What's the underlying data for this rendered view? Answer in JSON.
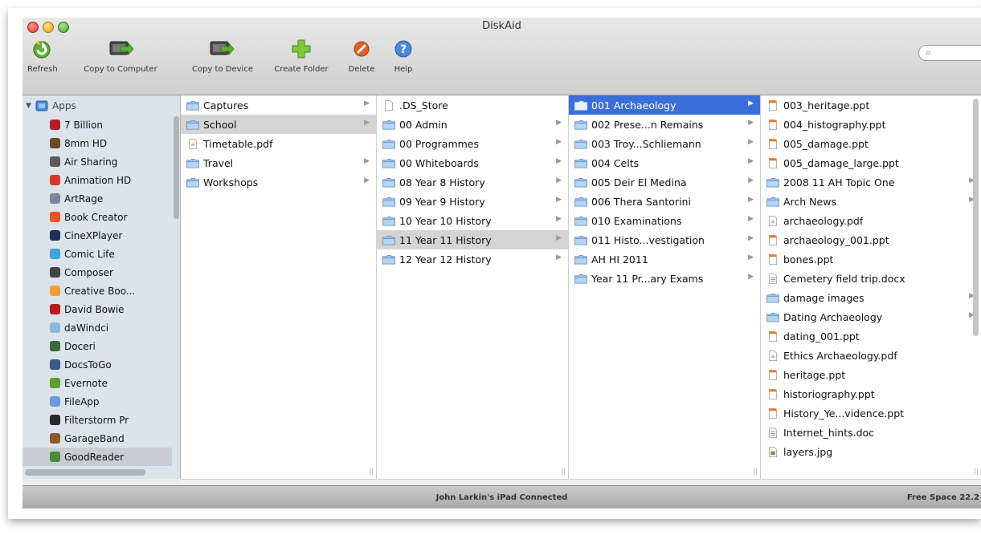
{
  "window": {
    "title": "DiskAid"
  },
  "toolbar": [
    {
      "label": "Refresh",
      "icon": "refresh-icon"
    },
    {
      "label": "Copy to Computer",
      "icon": "copy-to-computer-icon"
    },
    {
      "label": "Copy to Device",
      "icon": "copy-to-device-icon"
    },
    {
      "label": "Create Folder",
      "icon": "create-folder-icon"
    },
    {
      "label": "Delete",
      "icon": "delete-icon"
    },
    {
      "label": "Help",
      "icon": "help-icon"
    }
  ],
  "sidebar": {
    "header": "Apps",
    "items": [
      {
        "label": "7 Billion",
        "color": "#b01f24"
      },
      {
        "label": "8mm HD",
        "color": "#6b4a2a"
      },
      {
        "label": "Air Sharing",
        "color": "#5a5a5a"
      },
      {
        "label": "Animation HD",
        "color": "#d23a2e"
      },
      {
        "label": "ArtRage",
        "color": "#7a86a0"
      },
      {
        "label": "Book Creator",
        "color": "#e8562a"
      },
      {
        "label": "CineXPlayer",
        "color": "#1f2f5a"
      },
      {
        "label": "Comic Life",
        "color": "#3fa4d8"
      },
      {
        "label": "Composer",
        "color": "#444444"
      },
      {
        "label": "Creative Boo...",
        "color": "#f0a030"
      },
      {
        "label": "David Bowie",
        "color": "#b41e1e"
      },
      {
        "label": "daWindci",
        "color": "#8ab8d8"
      },
      {
        "label": "Doceri",
        "color": "#3a6a3a"
      },
      {
        "label": "DocsToGo",
        "color": "#3a5a8a"
      },
      {
        "label": "Evernote",
        "color": "#5aa02c"
      },
      {
        "label": "FileApp",
        "color": "#6a9ad8"
      },
      {
        "label": "Filterstorm Pr",
        "color": "#2a2a2a"
      },
      {
        "label": "GarageBand",
        "color": "#8a5a2a"
      },
      {
        "label": "GoodReader",
        "color": "#4a8a3a",
        "selected": true
      }
    ]
  },
  "columns": [
    {
      "items": [
        {
          "name": "Captures",
          "type": "folder",
          "arrow": true
        },
        {
          "name": "School",
          "type": "folder",
          "arrow": true,
          "selected": "gray"
        },
        {
          "name": "Timetable.pdf",
          "type": "pdf"
        },
        {
          "name": "Travel",
          "type": "folder",
          "arrow": true
        },
        {
          "name": "Workshops",
          "type": "folder",
          "arrow": true
        }
      ]
    },
    {
      "items": [
        {
          "name": ".DS_Store",
          "type": "file"
        },
        {
          "name": "00 Admin",
          "type": "folder",
          "arrow": true
        },
        {
          "name": "00 Programmes",
          "type": "folder",
          "arrow": true
        },
        {
          "name": "00 Whiteboards",
          "type": "folder",
          "arrow": true
        },
        {
          "name": "08 Year 8 History",
          "type": "folder",
          "arrow": true
        },
        {
          "name": "09 Year 9 History",
          "type": "folder",
          "arrow": true
        },
        {
          "name": "10 Year 10 History",
          "type": "folder",
          "arrow": true
        },
        {
          "name": "11 Year 11 History",
          "type": "folder",
          "arrow": true,
          "selected": "gray"
        },
        {
          "name": "12 Year 12 History",
          "type": "folder",
          "arrow": true
        }
      ]
    },
    {
      "items": [
        {
          "name": "001 Archaeology",
          "type": "folder",
          "arrow": true,
          "selected": "blue"
        },
        {
          "name": "002 Prese...n Remains",
          "type": "folder",
          "arrow": true
        },
        {
          "name": "003 Troy...Schliemann",
          "type": "folder",
          "arrow": true
        },
        {
          "name": "004 Celts",
          "type": "folder",
          "arrow": true
        },
        {
          "name": "005 Deir El Medina",
          "type": "folder",
          "arrow": true
        },
        {
          "name": "006 Thera Santorini",
          "type": "folder",
          "arrow": true
        },
        {
          "name": "010 Examinations",
          "type": "folder",
          "arrow": true
        },
        {
          "name": "011 Histo...vestigation",
          "type": "folder",
          "arrow": true
        },
        {
          "name": "AH HI 2011",
          "type": "folder",
          "arrow": true
        },
        {
          "name": "Year 11 Pr...ary Exams",
          "type": "folder",
          "arrow": true
        }
      ]
    },
    {
      "items": [
        {
          "name": "003_heritage.ppt",
          "type": "ppt"
        },
        {
          "name": "004_histography.ppt",
          "type": "ppt"
        },
        {
          "name": "005_damage.ppt",
          "type": "ppt"
        },
        {
          "name": "005_damage_large.ppt",
          "type": "ppt"
        },
        {
          "name": "2008 11 AH Topic One",
          "type": "folder",
          "arrow": true
        },
        {
          "name": "Arch News",
          "type": "folder",
          "arrow": true
        },
        {
          "name": "archaeology.pdf",
          "type": "pdf"
        },
        {
          "name": "archaeology_001.ppt",
          "type": "ppt"
        },
        {
          "name": "bones.ppt",
          "type": "ppt"
        },
        {
          "name": "Cemetery field trip.docx",
          "type": "doc"
        },
        {
          "name": "damage images",
          "type": "folder",
          "arrow": true
        },
        {
          "name": "Dating Archaeology",
          "type": "folder",
          "arrow": true
        },
        {
          "name": "dating_001.ppt",
          "type": "ppt"
        },
        {
          "name": "Ethics Archaeology.pdf",
          "type": "pdf"
        },
        {
          "name": "heritage.ppt",
          "type": "ppt"
        },
        {
          "name": "historiography.ppt",
          "type": "ppt"
        },
        {
          "name": "History_Ye...vidence.ppt",
          "type": "ppt"
        },
        {
          "name": "Internet_hints.doc",
          "type": "doc"
        },
        {
          "name": "layers.jpg",
          "type": "jpg"
        }
      ]
    }
  ],
  "status": {
    "connection": "John Larkin's iPad Connected",
    "free_space": "Free Space 22.2"
  }
}
